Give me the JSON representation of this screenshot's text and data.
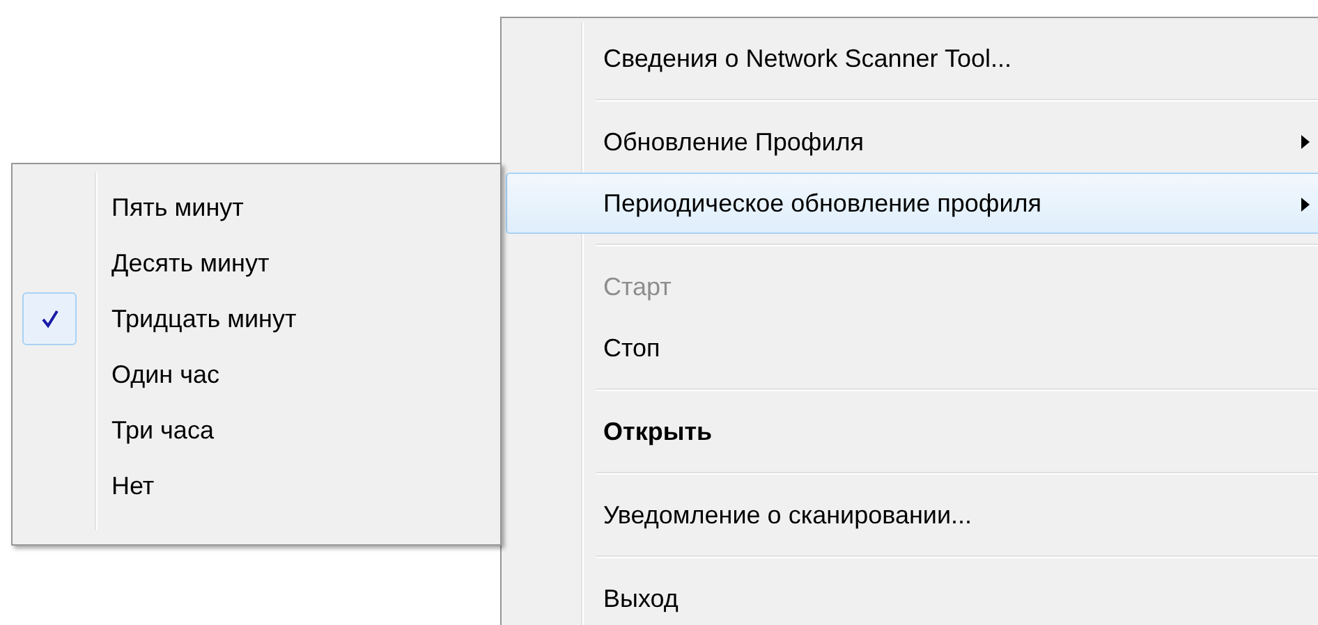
{
  "menu": {
    "sections": [
      {
        "items": [
          {
            "label": "Сведения о Network Scanner Tool...",
            "submenu": false,
            "disabled": false,
            "default": false,
            "selected": false
          }
        ]
      },
      {
        "items": [
          {
            "label": "Обновление Профиля",
            "submenu": true,
            "disabled": false,
            "default": false,
            "selected": false
          },
          {
            "label": "Периодическое обновление профиля",
            "submenu": true,
            "disabled": false,
            "default": false,
            "selected": true
          }
        ]
      },
      {
        "items": [
          {
            "label": "Старт",
            "submenu": false,
            "disabled": true,
            "default": false,
            "selected": false
          },
          {
            "label": "Стоп",
            "submenu": false,
            "disabled": false,
            "default": false,
            "selected": false
          }
        ]
      },
      {
        "items": [
          {
            "label": "Открыть",
            "submenu": false,
            "disabled": false,
            "default": true,
            "selected": false
          }
        ]
      },
      {
        "items": [
          {
            "label": "Уведомление о сканировании...",
            "submenu": false,
            "disabled": false,
            "default": false,
            "selected": false
          }
        ]
      },
      {
        "items": [
          {
            "label": "Выход",
            "submenu": false,
            "disabled": false,
            "default": false,
            "selected": false
          }
        ]
      }
    ]
  },
  "submenu": {
    "items": [
      {
        "label": "Пять минут",
        "checked": false
      },
      {
        "label": "Десять минут",
        "checked": false
      },
      {
        "label": "Тридцать минут",
        "checked": true
      },
      {
        "label": "Один час",
        "checked": false
      },
      {
        "label": "Три часа",
        "checked": false
      },
      {
        "label": "Нет",
        "checked": false
      }
    ]
  }
}
